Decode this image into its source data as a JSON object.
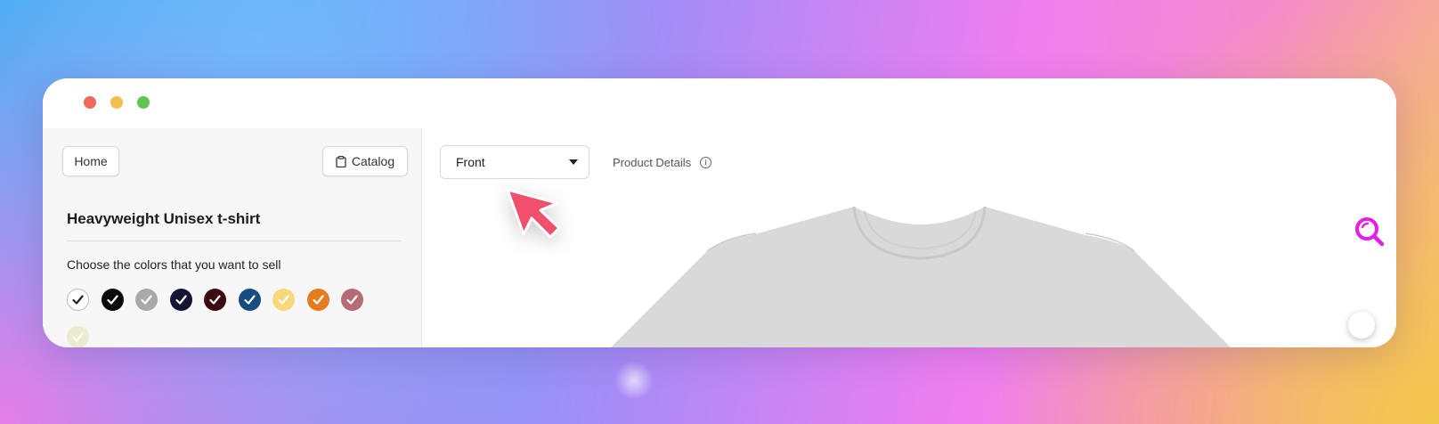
{
  "window": {
    "controls": [
      "close",
      "minimize",
      "zoom"
    ]
  },
  "sidebar": {
    "home_label": "Home",
    "catalog_label": "Catalog",
    "product_title": "Heavyweight Unisex t-shirt",
    "colors_prompt": "Choose the colors that you want to sell",
    "colors": [
      {
        "hex": "#ffffff",
        "check": "#222222",
        "selected": true
      },
      {
        "hex": "#0c0c0c",
        "check": "#ffffff",
        "selected": true
      },
      {
        "hex": "#a9a9a9",
        "check": "#ffffff",
        "selected": true
      },
      {
        "hex": "#141533",
        "check": "#ffffff",
        "selected": true
      },
      {
        "hex": "#3d0c11",
        "check": "#ffffff",
        "selected": true
      },
      {
        "hex": "#174c80",
        "check": "#ffffff",
        "selected": true
      },
      {
        "hex": "#f6d77a",
        "check": "#ffffff",
        "selected": true
      },
      {
        "hex": "#e57d20",
        "check": "#ffffff",
        "selected": true
      },
      {
        "hex": "#b86b74",
        "check": "#ffffff",
        "selected": true
      },
      {
        "hex": "#ecebcf",
        "check": "#ffffff",
        "selected": true
      }
    ]
  },
  "main": {
    "view_select": {
      "value": "Front"
    },
    "product_details_label": "Product Details",
    "shirt_color": "#d9d9d9",
    "accent_color": "#e91ee6"
  },
  "icons": {
    "catalog": "clipboard-icon",
    "details": "info-icon",
    "zoom": "search-icon",
    "pointer": "cursor-arrow-icon"
  }
}
